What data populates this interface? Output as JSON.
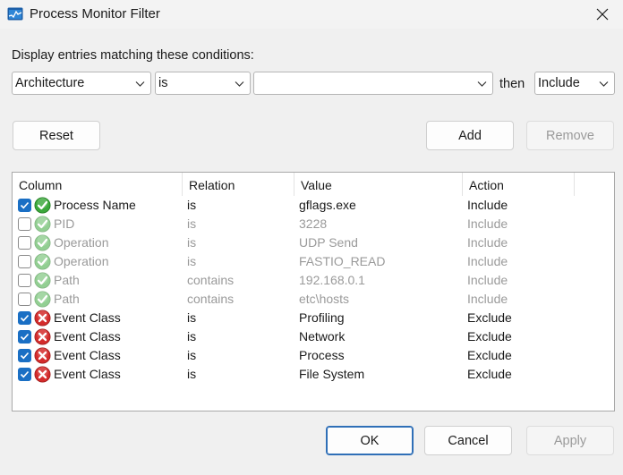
{
  "window": {
    "title": "Process Monitor Filter",
    "app_icon": "process-monitor-icon",
    "close_icon": "close-icon"
  },
  "prompt": "Display entries matching these conditions:",
  "condition": {
    "column_value": "Architecture",
    "relation_value": "is",
    "value_value": "",
    "then_label": "then",
    "action_value": "Include"
  },
  "buttons": {
    "reset": "Reset",
    "add": "Add",
    "remove": "Remove",
    "ok": "OK",
    "cancel": "Cancel",
    "apply": "Apply"
  },
  "list": {
    "columns": [
      "Column",
      "Relation",
      "Value",
      "Action"
    ],
    "rows": [
      {
        "checked": true,
        "status": "include",
        "column": "Process Name",
        "relation": "is",
        "value": "gflags.exe",
        "action": "Include"
      },
      {
        "checked": false,
        "status": "include",
        "column": "PID",
        "relation": "is",
        "value": "3228",
        "action": "Include"
      },
      {
        "checked": false,
        "status": "include",
        "column": "Operation",
        "relation": "is",
        "value": "UDP Send",
        "action": "Include"
      },
      {
        "checked": false,
        "status": "include",
        "column": "Operation",
        "relation": "is",
        "value": "FASTIO_READ",
        "action": "Include"
      },
      {
        "checked": false,
        "status": "include",
        "column": "Path",
        "relation": "contains",
        "value": "192.168.0.1",
        "action": "Include"
      },
      {
        "checked": false,
        "status": "include",
        "column": "Path",
        "relation": "contains",
        "value": "etc\\hosts",
        "action": "Include"
      },
      {
        "checked": true,
        "status": "exclude",
        "column": "Event Class",
        "relation": "is",
        "value": "Profiling",
        "action": "Exclude"
      },
      {
        "checked": true,
        "status": "exclude",
        "column": "Event Class",
        "relation": "is",
        "value": "Network",
        "action": "Exclude"
      },
      {
        "checked": true,
        "status": "exclude",
        "column": "Event Class",
        "relation": "is",
        "value": "Process",
        "action": "Exclude"
      },
      {
        "checked": true,
        "status": "exclude",
        "column": "Event Class",
        "relation": "is",
        "value": "File System",
        "action": "Exclude"
      }
    ]
  },
  "colors": {
    "accent": "#1a6fc4",
    "include_green": "#3aa83a",
    "exclude_red": "#d42b2b",
    "disabled_text": "#9a9a9a"
  }
}
